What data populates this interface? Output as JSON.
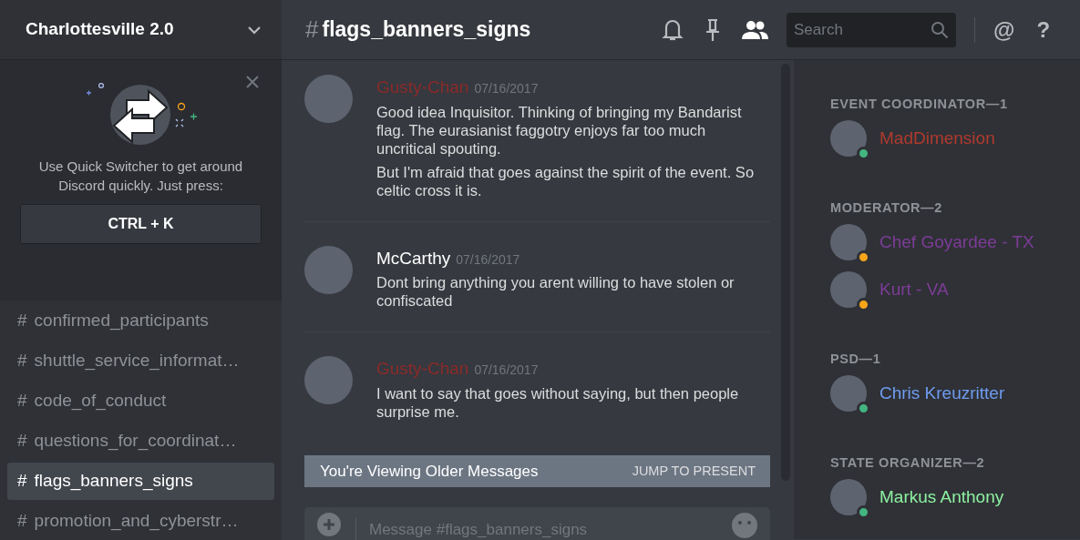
{
  "server": {
    "name": "Charlottesville 2.0"
  },
  "quick_switcher": {
    "text": "Use Quick Switcher to get around Discord quickly. Just press:",
    "shortcut": "CTRL + K"
  },
  "channels": [
    {
      "hash": "#",
      "name": "confirmed_participants",
      "selected": false
    },
    {
      "hash": "#",
      "name": "shuttle_service_informat…",
      "selected": false
    },
    {
      "hash": "#",
      "name": "code_of_conduct",
      "selected": false
    },
    {
      "hash": "#",
      "name": "questions_for_coordinat…",
      "selected": false
    },
    {
      "hash": "#",
      "name": "flags_banners_signs",
      "selected": true
    },
    {
      "hash": "#",
      "name": "promotion_and_cyberstr…",
      "selected": false
    }
  ],
  "header": {
    "hash": "#",
    "channel": "flags_banners_signs",
    "search": {
      "placeholder": "Search"
    },
    "mention": "@",
    "help": "?"
  },
  "messages": [
    {
      "author": "Gusty-Chan",
      "color": "#8a2a2a",
      "time": "07/16/2017",
      "paragraphs": [
        "Good idea Inquisitor. Thinking of bringing my Bandarist flag. The eurasianist faggotry enjoys far too much uncritical spouting.",
        "But I'm afraid that goes against the spirit of the event. So celtic cross it is."
      ]
    },
    {
      "author": "McCarthy",
      "color": "#ffffff",
      "time": "07/16/2017",
      "paragraphs": [
        "Dont bring anything you arent willing to have stolen or confiscated"
      ]
    },
    {
      "author": "Gusty-Chan",
      "color": "#8a2a2a",
      "time": "07/16/2017",
      "paragraphs": [
        "I want to say that goes without saying, but then people surprise me."
      ]
    }
  ],
  "older_bar": {
    "text": "You're Viewing Older Messages",
    "action": "JUMP TO PRESENT"
  },
  "composer": {
    "placeholder": "Message #flags_banners_signs"
  },
  "member_groups": [
    {
      "title": "EVENT COORDINATOR—1",
      "members": [
        {
          "name": "MadDimension",
          "color": "#b03a2e",
          "idle": false
        }
      ]
    },
    {
      "title": "MODERATOR—2",
      "members": [
        {
          "name": "Chef Goyardee - TX",
          "color": "#7d3c98",
          "idle": true
        },
        {
          "name": "Kurt - VA",
          "color": "#7d3c98",
          "idle": true
        }
      ]
    },
    {
      "title": "PSD—1",
      "members": [
        {
          "name": "Chris Kreuzritter",
          "color": "#6f9cf0",
          "idle": false
        }
      ]
    },
    {
      "title": "STATE ORGANIZER—2",
      "members": [
        {
          "name": "Markus Anthony",
          "color": "#8cf0a0",
          "idle": false
        }
      ]
    }
  ]
}
